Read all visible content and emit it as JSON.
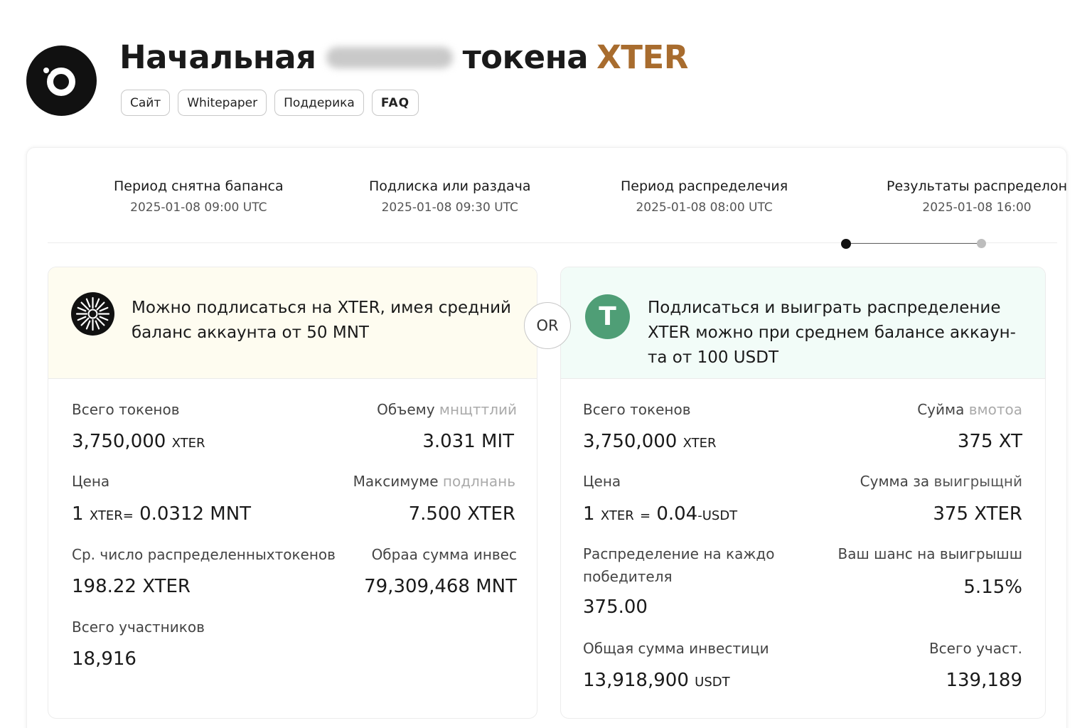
{
  "header": {
    "title_part1": "Начальная",
    "title_part2": "токена",
    "title_accent": "XTER",
    "links": [
      "Сайт",
      "Whitepaper",
      "Поддерика",
      "FAQ"
    ]
  },
  "stages": [
    {
      "title": "Период снятна бапанса",
      "date": "2025-01-08 09:00 UTC"
    },
    {
      "title": "Подлиска или раздача",
      "date": "2025-01-08 09:30 UTC"
    },
    {
      "title": "Период распределечия",
      "date": "2025-01-08 08:00 UTC"
    },
    {
      "title": "Результаты распределон",
      "date": "2025-01-08 16:00"
    }
  ],
  "or_label": "OR",
  "left_card": {
    "description": "Можно подлисаться  на XTER, имея средний баланс аккаунта от 50 MNT",
    "total_tokens_label": "Всего токенов",
    "total_tokens_value": "3,750,000",
    "total_tokens_unit": "XTER",
    "volume_label_a": "Объему",
    "volume_label_b": "мнщттлий",
    "volume_value": "3.031 MIT",
    "price_label": "Цена",
    "price_prefix": "1",
    "price_unit_a": "XTER",
    "price_eq": "=",
    "price_value": "0.0312 MNT",
    "max_label_a": "Максимуме",
    "max_label_b": "подлнань",
    "max_value": "7.500 XTER",
    "avg_label": "Ср. число распределенныхтокенов",
    "avg_value": "198.22 XTER",
    "sum_label": "Обраа сумма инвес",
    "sum_value": "79,309,468 MNT",
    "participants_label": "Всего участников",
    "participants_value": "18,916"
  },
  "right_card": {
    "description": "Подлисаться и выиграть распределение XTER можно при среднем балансе аккаун-та от 100 USDT",
    "icon_letter": "T",
    "total_tokens_label": "Всего токенов",
    "total_tokens_value": "3,750,000",
    "total_tokens_unit": "XTER",
    "sum_label_a": "Суйма",
    "sum_label_b": "вмотоа",
    "sum_value": "375 XT",
    "price_label": "Цена",
    "price_prefix": "1",
    "price_unit_a": "XTER",
    "price_eq": "=",
    "price_value": "0.04",
    "price_unit_b": "-USDT",
    "win_sum_label_a": "Сумма за",
    "win_sum_label_b": "выигрыщнй",
    "win_sum_value": "375 XTER",
    "per_winner_label_1": "Распределение на каждо",
    "per_winner_label_2": "победителя",
    "per_winner_value": "375.00",
    "chance_label": "Ваш шанс на выигрышш",
    "chance_value": "5.15%",
    "invest_label": "Общая сумма инвестици",
    "invest_value": "13,918,900",
    "invest_unit": "USDT",
    "participants_label": "Всего участ.",
    "participants_value": "139,189"
  }
}
